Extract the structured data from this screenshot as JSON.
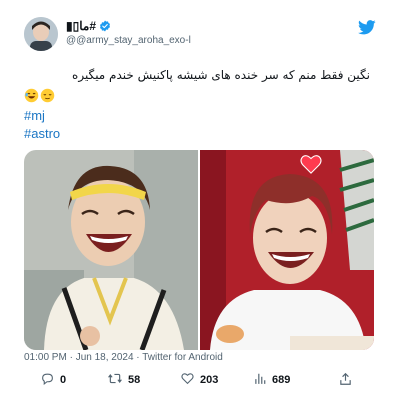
{
  "account": {
    "display_name": "▮▯ما#",
    "handle": "@@army_stay_aroha_exo-l"
  },
  "tweet": {
    "text": "نگین فقط منم که سر خنده های شیشه پاکنیش خندم میگیره",
    "hashtags": [
      "#mj",
      "#astro"
    ]
  },
  "meta": {
    "time": "01:00 PM",
    "date": "Jun 18, 2024",
    "source": "Twitter for Android"
  },
  "actions": {
    "replies": "0",
    "retweets": "58",
    "likes": "203",
    "views": "689"
  },
  "colors": {
    "accent": "#1d9bf0",
    "hashtag": "#1b76c4",
    "muted": "#536471"
  },
  "icons": [
    "verified-badge-icon",
    "twitter-bird-icon",
    "reply-icon",
    "retweet-icon",
    "heart-icon",
    "views-icon",
    "share-icon",
    "laughing-emoji-icon",
    "relieved-emoji-icon",
    "heart-sticker-icon"
  ]
}
